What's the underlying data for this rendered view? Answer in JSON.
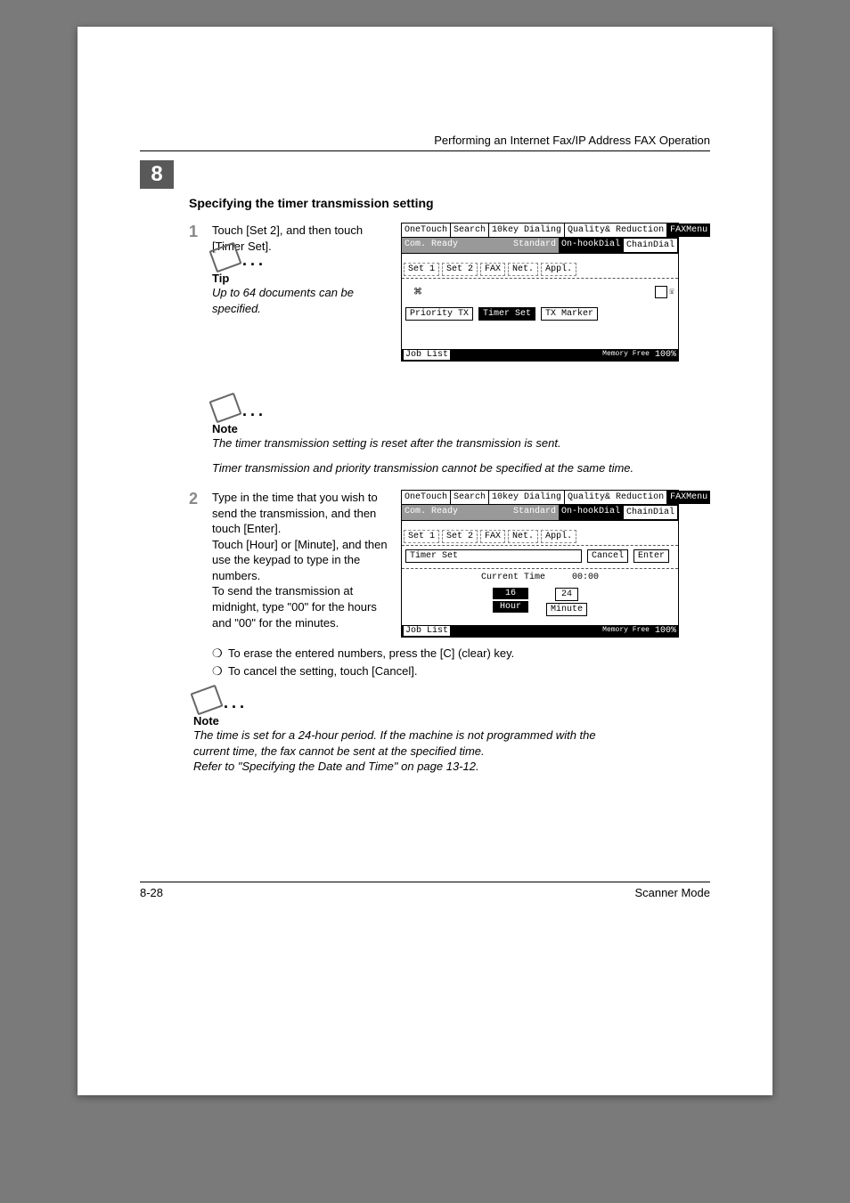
{
  "chapter_number": "8",
  "header_right": "Performing an Internet Fax/IP Address FAX Operation",
  "section_title": "Specifying the timer transmission setting",
  "step1": {
    "num": "1",
    "text": "Touch [Set 2], and then touch [Timer Set]."
  },
  "tip": {
    "title": "Tip",
    "body": "Up to 64 documents can be specified."
  },
  "note1": {
    "title": "Note",
    "line1": "The timer transmission setting is reset after the transmission is sent.",
    "line2": "Timer transmission and priority transmission cannot be specified at the same time."
  },
  "step2": {
    "num": "2",
    "text": "Type in the time that you wish to send the transmission, and then touch [Enter].\nTouch [Hour] or [Minute], and then use the keypad to type in the numbers.\nTo send the transmission at midnight, type \"00\" for the hours and \"00\" for the minutes."
  },
  "bullet1": "To erase the entered numbers, press the [C] (clear) key.",
  "bullet2": "To cancel the setting, touch [Cancel].",
  "note2": {
    "title": "Note",
    "line1": "The time is set for a 24-hour period. If the machine is not programmed with the current time, the fax cannot be sent at the specified time.",
    "line2": "Refer to \"Specifying the Date and Time\" on page 13-12."
  },
  "lcd_shared": {
    "tab_onetouch": "OneTouch",
    "tab_search": "Search",
    "tab_dialing": "10key\nDialing",
    "tab_quality": "Quality&\nReduction",
    "tab_faxmenu": "FAXMenu",
    "status_com": "Com. Ready",
    "status_std": "Standard",
    "status_onhook": "On-hookDial",
    "status_chain": "ChainDial",
    "opt_set1": "Set 1",
    "opt_set2": "Set 2",
    "opt_fax": "FAX",
    "opt_net": "Net.",
    "opt_appl": "Appl.",
    "job_list": "Job List",
    "mem": "Memory\nFree",
    "mem_pct": "100%"
  },
  "lcd1": {
    "priority": "Priority TX",
    "timer": "Timer Set",
    "txmarker": "TX Marker"
  },
  "lcd2": {
    "timer_set": "Timer Set",
    "cancel": "Cancel",
    "enter": "Enter",
    "current_time_label": "Current Time",
    "current_time_value": "00:00",
    "hour_val": "16",
    "hour_lbl": "Hour",
    "min_val": "24",
    "min_lbl": "Minute"
  },
  "footer_left": "8-28",
  "footer_right": "Scanner Mode",
  "bullet_dot": "❍"
}
